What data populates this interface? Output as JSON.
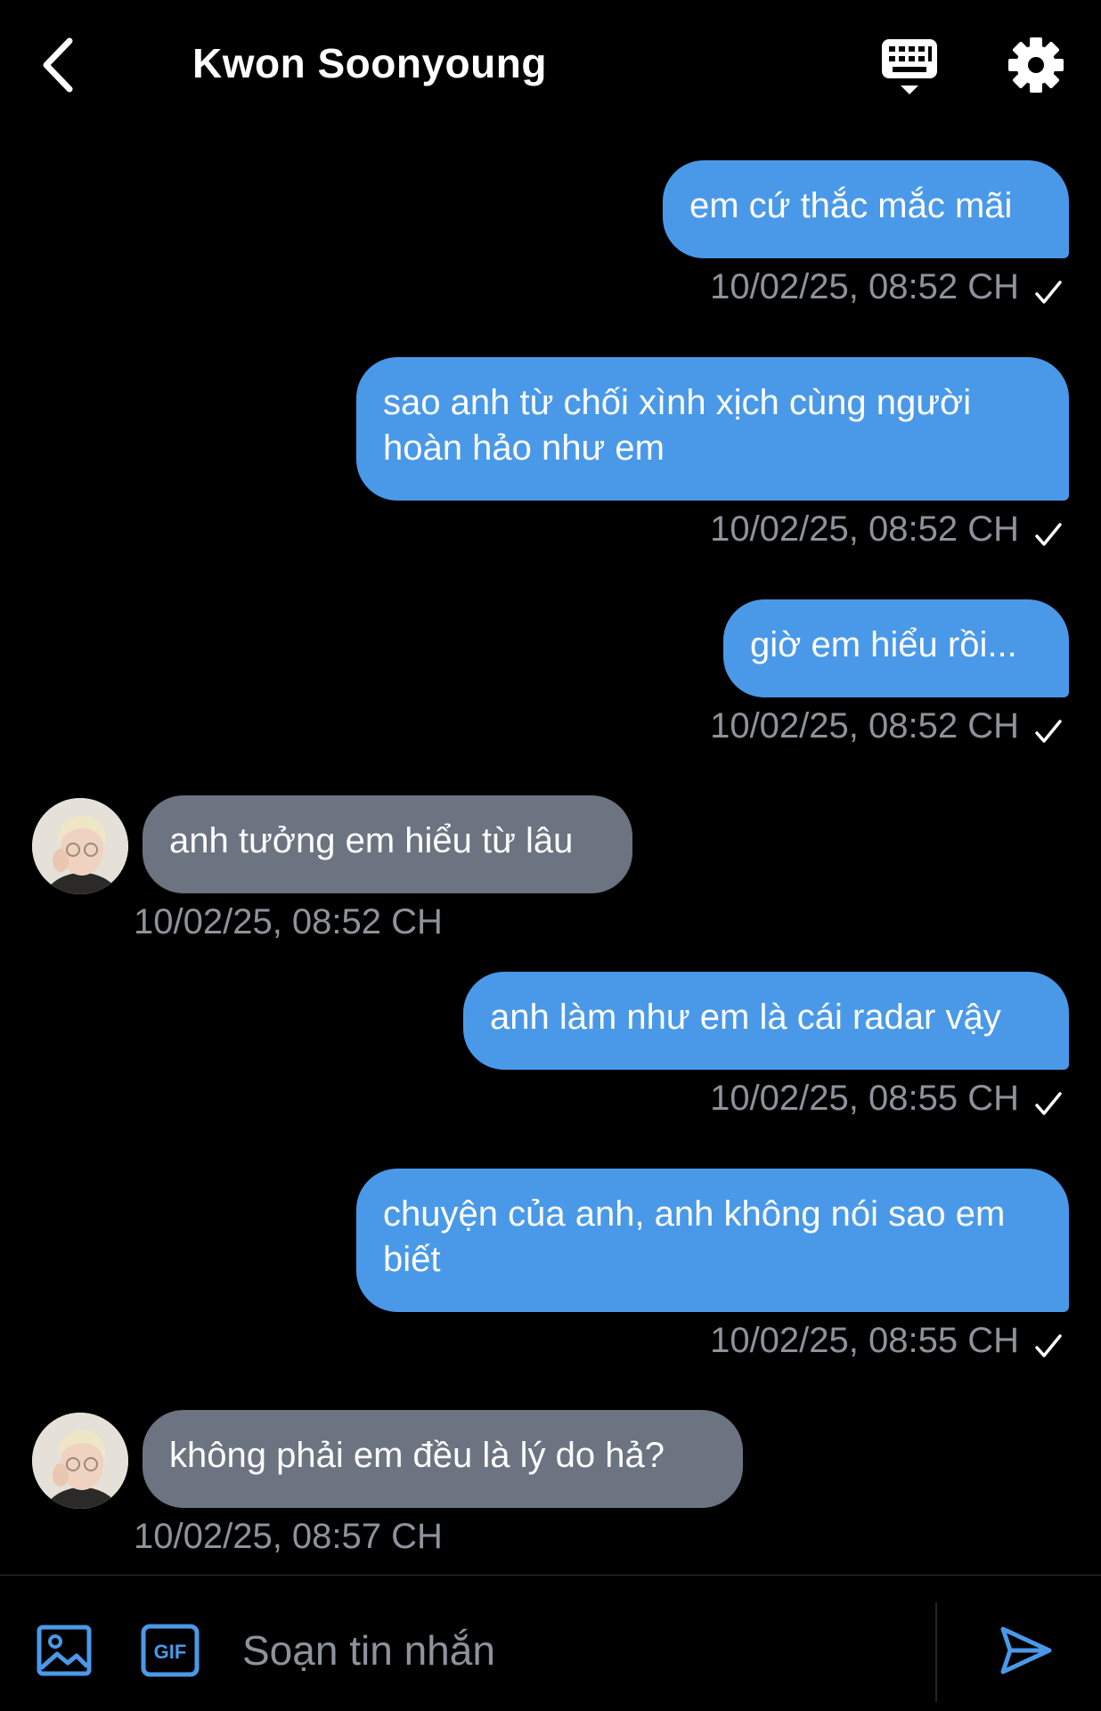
{
  "header": {
    "title": "Kwon Soonyoung",
    "back_icon": "chevron-left-icon",
    "keyboard_icon": "keyboard-icon",
    "settings_icon": "gear-icon"
  },
  "colors": {
    "outgoing_bubble": "#4A99E9",
    "incoming_bubble": "#6B7480",
    "timestamp": "#8D939B",
    "accent": "#4A99E9"
  },
  "messages": [
    {
      "direction": "out",
      "text": "em cứ thắc mắc mãi",
      "time": "10/02/25, 08:52 CH",
      "read_icon": "checkmark-icon"
    },
    {
      "direction": "out",
      "text": "sao anh từ chối xình xịch cùng người hoàn hảo như em",
      "time": "10/02/25, 08:52 CH",
      "read_icon": "checkmark-icon"
    },
    {
      "direction": "out",
      "text": "giờ em hiểu rồi...",
      "time": "10/02/25, 08:52 CH",
      "read_icon": "checkmark-icon"
    },
    {
      "direction": "in",
      "text": "anh tưởng em hiểu từ lâu",
      "time": "10/02/25, 08:52 CH"
    },
    {
      "direction": "out",
      "text": "anh làm như em là cái radar vậy",
      "time": "10/02/25, 08:55 CH",
      "read_icon": "checkmark-icon"
    },
    {
      "direction": "out",
      "text": "chuyện của anh, anh không nói sao em biết",
      "time": "10/02/25, 08:55 CH",
      "read_icon": "checkmark-icon"
    },
    {
      "direction": "in",
      "text": "không phải em đều là lý do hả?",
      "time": "10/02/25, 08:57 CH"
    }
  ],
  "composer": {
    "placeholder": "Soạn tin nhắn",
    "image_icon": "image-icon",
    "gif_label": "GIF",
    "send_icon": "send-icon"
  }
}
